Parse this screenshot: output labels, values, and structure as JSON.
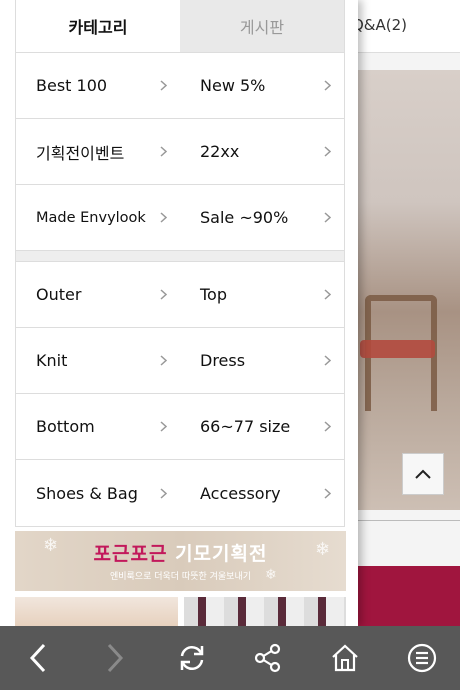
{
  "tabs": {
    "category": "카테고리",
    "board": "게시판"
  },
  "background": {
    "qa_label": "Q&A(2)"
  },
  "menu": {
    "rows": [
      [
        "Best 100",
        "New 5%"
      ],
      [
        "기획전이벤트",
        "22xx"
      ],
      [
        "Made Envylook",
        "Sale ~90%"
      ],
      [
        "Outer",
        "Top"
      ],
      [
        "Knit",
        "Dress"
      ],
      [
        "Bottom",
        "66~77 size"
      ],
      [
        "Shoes & Bag",
        "Accessory"
      ]
    ]
  },
  "banner": {
    "title_pink": "포근포근",
    "title_white": "기모기획전",
    "subtitle": "엔비룩으로 더욱더 따뜻한 겨울보내기"
  },
  "colors": {
    "bottom_bar": "#585858",
    "banner_pink": "#c2185b",
    "background_accent": "#a0153e"
  },
  "icons": [
    "back-icon",
    "forward-icon",
    "refresh-icon",
    "share-icon",
    "home-icon",
    "menu-icon",
    "chevron-right-icon",
    "chevron-up-icon"
  ]
}
